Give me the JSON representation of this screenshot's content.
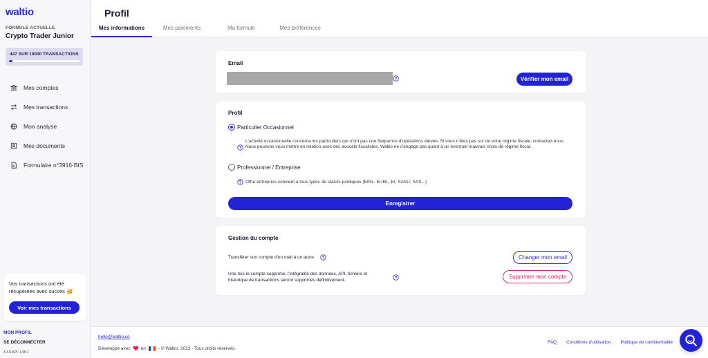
{
  "brand": {
    "logo": "waltio",
    "accent": "#2a2ad8"
  },
  "sidebar": {
    "plan_label": "FORMULE ACTUELLE",
    "plan_name": "Crypto Trader Junior",
    "transactions": {
      "text": "447 SUR 10000 TRANSACTIONS",
      "used": 447,
      "total": 10000
    },
    "items": [
      {
        "label": "Mes comptes",
        "icon": "bank-icon"
      },
      {
        "label": "Mes transactions",
        "icon": "arrows-icon"
      },
      {
        "label": "Mon analyse",
        "icon": "globe-icon"
      },
      {
        "label": "Mes documents",
        "icon": "document-icon"
      },
      {
        "label": "Formulaire n°3916-BIS",
        "icon": "file-icon"
      }
    ],
    "notice": {
      "text": "Vos transactions ont été récupérées avec succès 🥳",
      "button": "Voir mes transactions"
    },
    "profile_link": "MON PROFIL",
    "logout_link": "SE DÉCONNECTER",
    "version": "4.3.0 API: 1.98.1"
  },
  "header": {
    "title": "Profil",
    "tabs": [
      {
        "label": "Mes informations",
        "active": true
      },
      {
        "label": "Mes paiements",
        "active": false
      },
      {
        "label": "Ma formule",
        "active": false
      },
      {
        "label": "Mes préférences",
        "active": false
      }
    ]
  },
  "email_card": {
    "title": "Email",
    "value": "",
    "verify_button": "Vérifier mon email"
  },
  "profil_card": {
    "title": "Profil",
    "options": [
      {
        "label": "Particulier Occasionnel",
        "checked": true,
        "description": "L'activité occasionnelle concerne les particuliers qui n'ont pas une fréquence d'opérations élevée. Si vous n'êtes pas sur de votre régime fiscale, contactez-nous. Nous pouvons vous mettre en relation avec des avocats fiscalistes. Waltio ne s'engage pas quant à un éventuel mauvais choix de régime fiscal."
      },
      {
        "label": "Professionnel / Entreprise",
        "checked": false,
        "description": "Offre entreprise convient à tous types de statuts juridiques (EIRL, EURL, EI, SASU, SAS...)"
      }
    ],
    "save_button": "Enregistrer"
  },
  "account_card": {
    "title": "Gestion du compte",
    "transfer_text": "Transférer son compte d'un mail à un autre.",
    "change_email_button": "Changer mon email",
    "delete_text": "Une fois le compte supprimé, l'intégralité des données, API, fichiers et historique de transactions seront supprimés définitivement.",
    "delete_button": "Supprimer mon compte"
  },
  "footer": {
    "email": "hello@waltio.co",
    "dev_prefix": "Développé avec",
    "dev_in": "en",
    "dev_suffix": "- © Waltio, 2022 - Tous droits réservés.",
    "links": [
      "FAQ",
      "Conditions d'utilisation",
      "Politique de confidentialité"
    ]
  },
  "colors": {
    "primary": "#2222d6",
    "danger": "#e0245e",
    "background": "#f4f4f7"
  }
}
